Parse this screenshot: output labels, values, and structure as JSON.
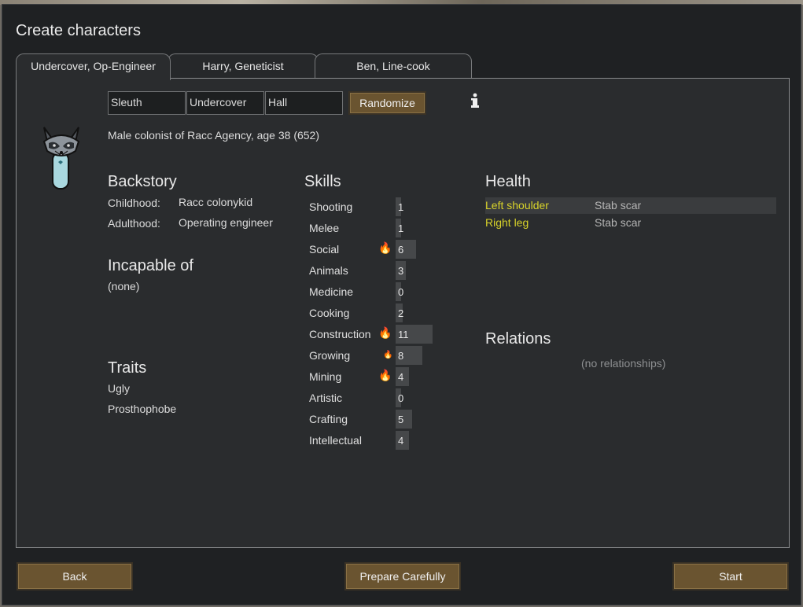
{
  "window": {
    "title": "Create characters"
  },
  "tabs": [
    {
      "label": "Undercover, Op-Engineer",
      "active": true
    },
    {
      "label": "Harry, Geneticist",
      "active": false
    },
    {
      "label": "Ben, Line-cook",
      "active": false
    }
  ],
  "name": {
    "first": "Sleuth",
    "nick": "Undercover",
    "last": "Hall"
  },
  "randomize_label": "Randomize",
  "info_icon": "info-icon",
  "description": "Male colonist of Racc Agency, age 38 (652)",
  "backstory": {
    "heading": "Backstory",
    "childhood_label": "Childhood:",
    "childhood_value": "Racc colonykid",
    "adulthood_label": "Adulthood:",
    "adulthood_value": "Operating engineer"
  },
  "incapable": {
    "heading": "Incapable of",
    "value": "(none)"
  },
  "traits": {
    "heading": "Traits",
    "items": [
      "Ugly",
      "Prosthophobe"
    ]
  },
  "skills": {
    "heading": "Skills",
    "items": [
      {
        "name": "Shooting",
        "level": "1",
        "passion": 0
      },
      {
        "name": "Melee",
        "level": "1",
        "passion": 0
      },
      {
        "name": "Social",
        "level": "6",
        "passion": 2
      },
      {
        "name": "Animals",
        "level": "3",
        "passion": 0
      },
      {
        "name": "Medicine",
        "level": "0",
        "passion": 0
      },
      {
        "name": "Cooking",
        "level": "2",
        "passion": 0
      },
      {
        "name": "Construction",
        "level": "11",
        "passion": 2
      },
      {
        "name": "Growing",
        "level": "8",
        "passion": 1
      },
      {
        "name": "Mining",
        "level": "4",
        "passion": 2
      },
      {
        "name": "Artistic",
        "level": "0",
        "passion": 0
      },
      {
        "name": "Crafting",
        "level": "5",
        "passion": 0
      },
      {
        "name": "Intellectual",
        "level": "4",
        "passion": 0
      }
    ]
  },
  "health": {
    "heading": "Health",
    "items": [
      {
        "part": "Left shoulder",
        "condition": "Stab scar"
      },
      {
        "part": "Right leg",
        "condition": "Stab scar"
      }
    ]
  },
  "relations": {
    "heading": "Relations",
    "empty": "(no relationships)"
  },
  "buttons": {
    "back": "Back",
    "prepare": "Prepare Carefully",
    "start": "Start"
  },
  "colors": {
    "button": "#6a5430",
    "health_part": "#d8d32a",
    "passion": "#f0a020"
  }
}
